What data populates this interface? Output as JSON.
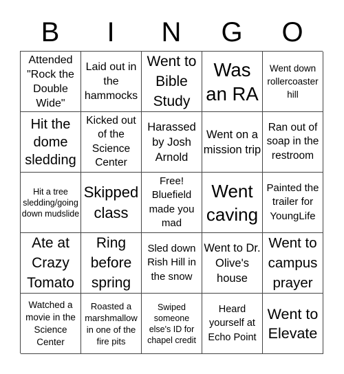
{
  "header": [
    "B",
    "I",
    "N",
    "G",
    "O"
  ],
  "cells": [
    "Attended \"Rock the Double Wide\"",
    "Laid out in the hammocks",
    "Went to Bible Study",
    "Was an RA",
    "Went down rollercoaster hill",
    "Hit the dome sledding",
    "Kicked out of the Science Center",
    "Harassed by Josh Arnold",
    "Went on a mission trip",
    "Ran out of soap in the restroom",
    "Hit a tree sledding/going down mudslide",
    "Skipped class",
    "Free! Bluefield made you mad",
    "Went caving",
    "Painted the trailer for YoungLife",
    "Ate at Crazy Tomato",
    "Ring before spring",
    "Sled down Rish Hill in the snow",
    "Went to Dr. Olive's house",
    "Went to campus prayer",
    "Watched a movie in the Science Center",
    "Roasted a marshmallow in one of the fire pits",
    "Swiped someone else's ID for chapel credit",
    "Heard yourself at Echo Point",
    "Went to Elevate"
  ]
}
